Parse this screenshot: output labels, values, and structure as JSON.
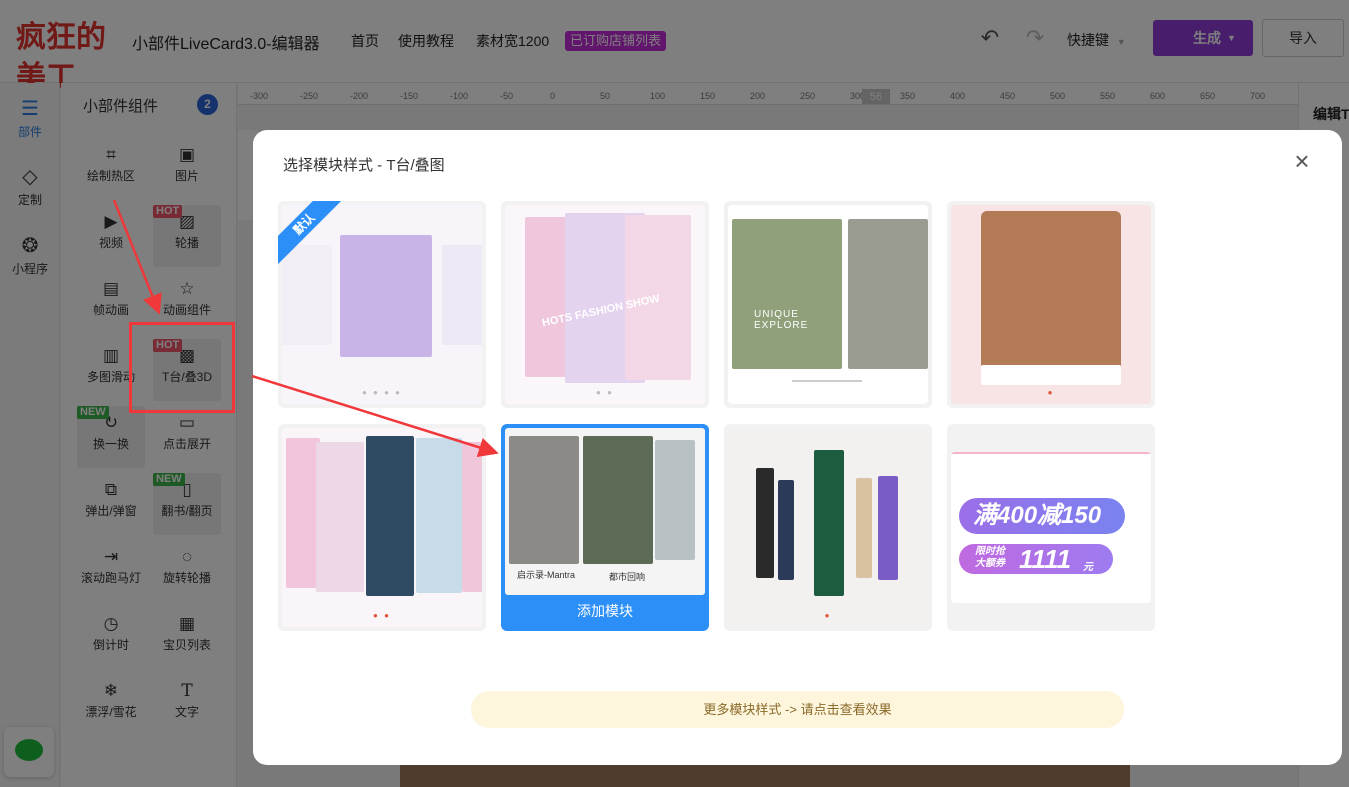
{
  "header": {
    "logo_text": "疯狂的美工",
    "app_title": "小部件LiveCard3.0-编辑器",
    "nav": [
      "首页",
      "使用教程",
      "素材宽1200"
    ],
    "shop_badge": "已订购店铺列表",
    "shortcut_label": "快捷键",
    "generate_label": "生成",
    "import_label": "导入"
  },
  "rail": {
    "items": [
      {
        "label": "部件",
        "icon": "list-icon",
        "active": true
      },
      {
        "label": "定制",
        "icon": "diamond-icon"
      },
      {
        "label": "小程序",
        "icon": "miniprogram-icon"
      }
    ]
  },
  "panel": {
    "title": "小部件组件",
    "count": "2",
    "widgets": [
      {
        "label": "绘制热区",
        "icon": "hotspot-icon"
      },
      {
        "label": "图片",
        "icon": "image-icon"
      },
      {
        "label": "视频",
        "icon": "video-icon"
      },
      {
        "label": "轮播",
        "icon": "carousel-icon",
        "tag": "HOT"
      },
      {
        "label": "帧动画",
        "icon": "frame-animation-icon"
      },
      {
        "label": "动画组件",
        "icon": "star-icon"
      },
      {
        "label": "多图滑动",
        "icon": "multi-image-icon"
      },
      {
        "label": "T台/叠3D",
        "icon": "gallery-icon",
        "tag": "HOT"
      },
      {
        "label": "换一换",
        "icon": "refresh-icon",
        "tag": "NEW"
      },
      {
        "label": "点击展开",
        "icon": "expand-icon"
      },
      {
        "label": "弹出/弹窗",
        "icon": "popup-icon"
      },
      {
        "label": "翻书/翻页",
        "icon": "book-icon",
        "tag": "NEW"
      },
      {
        "label": "滚动跑马灯",
        "icon": "marquee-icon"
      },
      {
        "label": "旋转轮播",
        "icon": "rotate-icon"
      },
      {
        "label": "倒计时",
        "icon": "clock-icon"
      },
      {
        "label": "宝贝列表",
        "icon": "grid-icon"
      },
      {
        "label": "漂浮/雪花",
        "icon": "snowflake-icon"
      },
      {
        "label": "文字",
        "icon": "text-icon"
      }
    ]
  },
  "ruler": {
    "ticks": [
      "-300",
      "-250",
      "-200",
      "-150",
      "-100",
      "-50",
      "0",
      "50",
      "100",
      "150",
      "200",
      "250",
      "300",
      "350",
      "400",
      "450",
      "500",
      "550",
      "600",
      "650",
      "700"
    ],
    "highlight": "56"
  },
  "right_panel": {
    "title": "编辑T"
  },
  "modal": {
    "title": "选择模块样式 - T台/叠图",
    "default_tag": "默认",
    "add_module_label": "添加模块",
    "more_styles": "更多模块样式 -> 请点击查看效果",
    "cards": [
      {
        "style": "runway-purple"
      },
      {
        "style": "stacked-pink",
        "caption": "HOTS FASHION SHOW"
      },
      {
        "style": "explore-nature",
        "caption": "UNIQUE EXPLORE"
      },
      {
        "style": "fur-portrait"
      },
      {
        "style": "sneaker-fan"
      },
      {
        "style": "fashion-3d",
        "captions": [
          "启示录-Mantra",
          "都市回响"
        ],
        "selected": true
      },
      {
        "style": "group-lineup"
      },
      {
        "style": "promo-coupons",
        "promo1": "满400减150",
        "promo2_a": "限时抢",
        "promo2_b": "大额券",
        "promo2_c": "1111",
        "promo2_d": "元"
      }
    ]
  }
}
